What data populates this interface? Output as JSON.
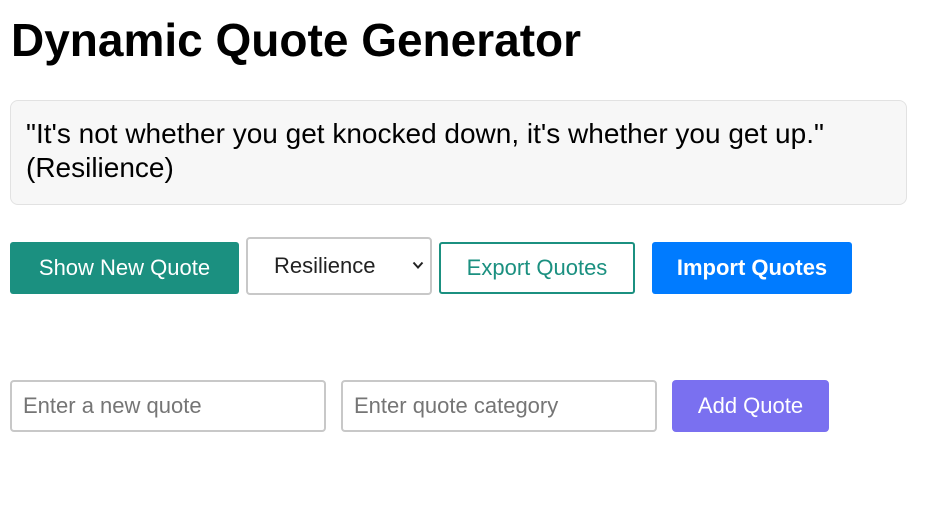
{
  "page": {
    "title": "Dynamic Quote Generator"
  },
  "quote_display": {
    "text": "\"It's not whether you get knocked down, it's whether you get up.\"",
    "category": "(Resilience)"
  },
  "controls": {
    "show_new_quote_label": "Show New Quote",
    "category_filter": {
      "selected": "Resilience"
    },
    "export_label": "Export Quotes",
    "import_label": "Import Quotes"
  },
  "add_form": {
    "quote_placeholder": "Enter a new quote",
    "category_placeholder": "Enter quote category",
    "add_label": "Add Quote"
  },
  "colors": {
    "primary_teal": "#1b9080",
    "import_blue": "#007bff",
    "add_purple": "#7a70f0"
  },
  "icons": {
    "select_arrow": "chevron-down-icon"
  }
}
